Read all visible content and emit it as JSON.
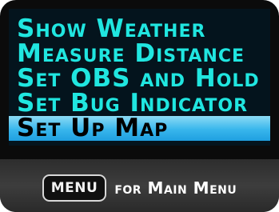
{
  "menu": {
    "items": [
      {
        "label": "Show Weather"
      },
      {
        "label": "Measure Distance"
      },
      {
        "label": "Set OBS and Hold"
      },
      {
        "label": "Set Bug Indicator"
      },
      {
        "label": "Set Up Map",
        "selected": true
      }
    ]
  },
  "footer": {
    "menu_key_label": "MENU",
    "hint_text": "for Main Menu"
  },
  "colors": {
    "menu_text": "#20e6e0",
    "selected_highlight": "#38b6ec",
    "screen_background": "#04141d",
    "bezel": "#0b0b0b"
  }
}
